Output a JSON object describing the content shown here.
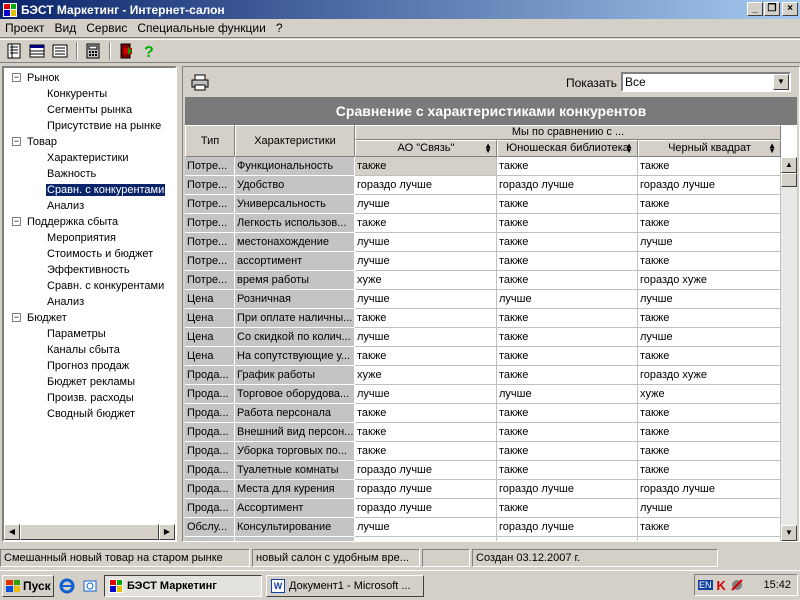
{
  "window": {
    "title": "БЭСТ Маркетинг - Интернет-салон",
    "min_label": "_",
    "max_label": "❐",
    "close_label": "×"
  },
  "menu": [
    "Проект",
    "Вид",
    "Сервис",
    "Специальные функции",
    "?"
  ],
  "toolbar_icons": [
    "document-icon",
    "table-icon",
    "list-icon",
    "calculator-icon",
    "exit-icon",
    "help-icon"
  ],
  "tree": [
    {
      "label": "Рынок",
      "level": 0,
      "expander": "−"
    },
    {
      "label": "Конкуренты",
      "level": 1
    },
    {
      "label": "Сегменты рынка",
      "level": 1
    },
    {
      "label": "Присутствие на рынке",
      "level": 1
    },
    {
      "label": "Товар",
      "level": 0,
      "expander": "−"
    },
    {
      "label": "Характеристики",
      "level": 1
    },
    {
      "label": "Важность",
      "level": 1
    },
    {
      "label": "Сравн. с конкурентами",
      "level": 1,
      "selected": true
    },
    {
      "label": "Анализ",
      "level": 1
    },
    {
      "label": "Поддержка сбыта",
      "level": 0,
      "expander": "−"
    },
    {
      "label": "Мероприятия",
      "level": 1
    },
    {
      "label": "Стоимость и бюджет",
      "level": 1
    },
    {
      "label": "Эффективность",
      "level": 1
    },
    {
      "label": "Сравн. с конкурентами",
      "level": 1
    },
    {
      "label": "Анализ",
      "level": 1
    },
    {
      "label": "Бюджет",
      "level": 0,
      "expander": "−"
    },
    {
      "label": "Параметры",
      "level": 1
    },
    {
      "label": "Каналы сбыта",
      "level": 1
    },
    {
      "label": "Прогноз продаж",
      "level": 1
    },
    {
      "label": "Бюджет рекламы",
      "level": 1
    },
    {
      "label": "Произв. расходы",
      "level": 1
    },
    {
      "label": "Сводный бюджет",
      "level": 1
    }
  ],
  "filter": {
    "label": "Показать",
    "value": "Все",
    "arrow": "▼"
  },
  "grid": {
    "title": "Сравнение с характеристиками конкурентов",
    "col_type": "Тип",
    "col_char": "Характеристики",
    "group_header": "Мы по сравнению с ...",
    "competitors": [
      "АО \"Связь\"",
      "Юношеская библиотека",
      "Черный квадрат"
    ],
    "rows": [
      {
        "type": "Потре...",
        "char": "Функциональность",
        "v": [
          "также",
          "также",
          "также"
        ]
      },
      {
        "type": "Потре...",
        "char": "Удобство",
        "v": [
          "гораздо лучше",
          "гораздо лучше",
          "гораздо лучше"
        ]
      },
      {
        "type": "Потре...",
        "char": "Универсальность",
        "v": [
          "лучше",
          "также",
          "также"
        ]
      },
      {
        "type": "Потре...",
        "char": "Легкость использов...",
        "v": [
          "также",
          "также",
          "также"
        ]
      },
      {
        "type": "Потре...",
        "char": "местонахождение",
        "v": [
          "лучше",
          "также",
          "лучше"
        ]
      },
      {
        "type": "Потре...",
        "char": "ассортимент",
        "v": [
          "лучше",
          "также",
          "также"
        ]
      },
      {
        "type": "Потре...",
        "char": "время работы",
        "v": [
          "хуже",
          "также",
          "гораздо хуже"
        ]
      },
      {
        "type": "Цена",
        "char": "Розничная",
        "v": [
          "лучше",
          "лучше",
          "лучше"
        ]
      },
      {
        "type": "Цена",
        "char": "При оплате наличны...",
        "v": [
          "также",
          "также",
          "также"
        ]
      },
      {
        "type": "Цена",
        "char": "Со скидкой по колич...",
        "v": [
          "лучше",
          "также",
          "лучше"
        ]
      },
      {
        "type": "Цена",
        "char": "На сопутствующие у...",
        "v": [
          "также",
          "также",
          "также"
        ]
      },
      {
        "type": "Прода...",
        "char": "График работы",
        "v": [
          "хуже",
          "также",
          "гораздо хуже"
        ]
      },
      {
        "type": "Прода...",
        "char": "Торговое оборудова...",
        "v": [
          "лучше",
          "лучше",
          "хуже"
        ]
      },
      {
        "type": "Прода...",
        "char": "Работа персонала",
        "v": [
          "также",
          "также",
          "также"
        ]
      },
      {
        "type": "Прода...",
        "char": "Внешний вид персон...",
        "v": [
          "также",
          "также",
          "также"
        ]
      },
      {
        "type": "Прода...",
        "char": "Уборка торговых по...",
        "v": [
          "также",
          "также",
          "также"
        ]
      },
      {
        "type": "Прода...",
        "char": "Туалетные комнаты",
        "v": [
          "гораздо лучше",
          "также",
          "также"
        ]
      },
      {
        "type": "Прода...",
        "char": "Места для курения",
        "v": [
          "гораздо лучше",
          "гораздо лучше",
          "гораздо лучше"
        ]
      },
      {
        "type": "Прода...",
        "char": "Ассортимент",
        "v": [
          "гораздо лучше",
          "также",
          "лучше"
        ]
      },
      {
        "type": "Обслу...",
        "char": "Консультирование",
        "v": [
          "лучше",
          "гораздо лучше",
          "также"
        ]
      },
      {
        "type": "Обслу...",
        "char": "",
        "v": [
          "",
          "",
          ""
        ]
      }
    ]
  },
  "status": {
    "p1": "Смешанный новый товар на старом рынке",
    "p2": "новый салон с удобным вре...",
    "p3": "",
    "p4": "Создан 03.12.2007 г."
  },
  "taskbar": {
    "start": "Пуск",
    "tasks": [
      "БЭСТ Маркетинг",
      "Документ1 - Microsoft ..."
    ],
    "tray_lang": "EN",
    "clock": "15:42"
  },
  "colors": {
    "title_start": "#0a246a",
    "title_end": "#a6caf0",
    "grid_title_bg": "#7a7a7a",
    "selection": "#0a246a"
  }
}
